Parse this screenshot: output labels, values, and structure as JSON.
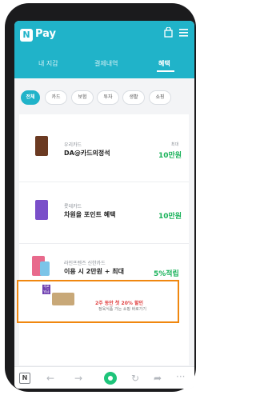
{
  "header": {
    "logo_letter": "N",
    "app_name": "Pay",
    "icons": [
      "bag-icon",
      "menu-icon"
    ]
  },
  "tabs": [
    {
      "label": "내 지갑",
      "active": false
    },
    {
      "label": "결제내역",
      "active": false
    },
    {
      "label": "혜택",
      "active": true
    }
  ],
  "filter_chips": [
    {
      "label": "전체",
      "active": true
    },
    {
      "label": "카드",
      "active": false
    },
    {
      "label": "보험",
      "active": false
    },
    {
      "label": "투자",
      "active": false
    },
    {
      "label": "생활",
      "active": false
    },
    {
      "label": "쇼핑",
      "active": false
    }
  ],
  "benefits": [
    {
      "issuer": "우리카드",
      "title": "DA@카드의정석",
      "tag": "최대",
      "value": "10만원",
      "color": "#6b3a22"
    },
    {
      "issuer": "롯데카드",
      "title": "차원을 포인트 혜택",
      "tag": "",
      "value": "10만원",
      "color": "#7a4fc9"
    },
    {
      "issuer": "라인프렌즈 신한카드",
      "title": "이용 시 2만원 + 최대",
      "tag": "",
      "value": "5%적립",
      "color": "#e86a8c"
    }
  ],
  "ad": {
    "badge": "쿠폰 발급",
    "title": "2주 동안 첫 20% 할인",
    "subtitle": "정육식품 가는 쇼핑 바로가기"
  },
  "bottom_nav": {
    "n_label": "N"
  },
  "colors": {
    "brand": "#20b3c9",
    "value_green": "#1ab25a",
    "highlight_orange": "#f0870f"
  }
}
